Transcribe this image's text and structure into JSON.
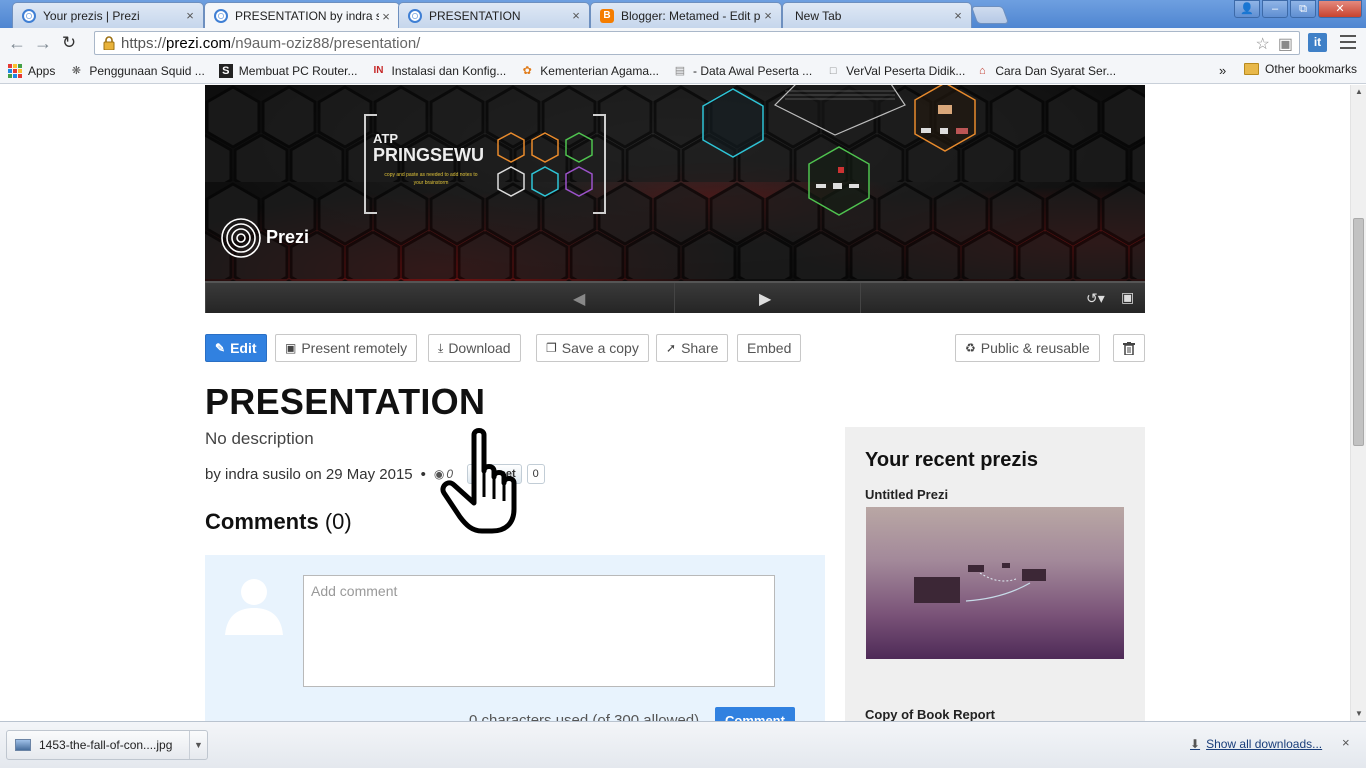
{
  "browser": {
    "tabs": [
      {
        "title": "Your prezis | Prezi",
        "icon": "prezi-icon",
        "active": false
      },
      {
        "title": "PRESENTATION by indra s",
        "icon": "prezi-icon",
        "active": true
      },
      {
        "title": "PRESENTATION",
        "icon": "prezi-icon",
        "active": false
      },
      {
        "title": "Blogger: Metamed - Edit p",
        "icon": "blogger-icon",
        "active": false
      },
      {
        "title": "New Tab",
        "icon": "",
        "active": false
      }
    ],
    "close_glyph": "×",
    "url_scheme": "https://",
    "url_host": "prezi.com",
    "url_path": "/n9aum-oziz88/presentation/",
    "extension_label": "it",
    "bookmarks": [
      {
        "label": "Apps",
        "icon": "apps-grid-icon"
      },
      {
        "label": "Penggunaan Squid ...",
        "icon": "squid-icon"
      },
      {
        "label": "Membuat PC Router...",
        "icon": "s-logo-icon"
      },
      {
        "label": "Instalasi dan Konfig...",
        "icon": "in-logo-icon"
      },
      {
        "label": "Kementerian Agama...",
        "icon": "leaf-icon"
      },
      {
        "label": "- Data Awal Peserta ...",
        "icon": "doc-icon"
      },
      {
        "label": "VerVal Peserta Didik...",
        "icon": "page-icon"
      },
      {
        "label": "Cara Dan Syarat Ser...",
        "icon": "house-icon"
      }
    ],
    "bookmarks_overflow": "»",
    "other_bookmarks": "Other bookmarks"
  },
  "player": {
    "slide_title_small": "ATP",
    "slide_title_big": "PRINGSEWU",
    "slide_hint": "copy and paste as needed to add notes to your brainstorm",
    "brand": "Prezi",
    "colors": {
      "accent_cyan": "#2ec4d6",
      "accent_orange": "#e88a2c",
      "accent_green": "#4fc34f",
      "accent_purple": "#9b52c9"
    }
  },
  "actions": {
    "edit": "Edit",
    "present_remotely": "Present remotely",
    "download": "Download",
    "save_copy": "Save a copy",
    "share": "Share",
    "embed": "Embed",
    "public_reusable": "Public & reusable"
  },
  "presentation": {
    "title": "PRESENTATION",
    "description": "No description",
    "by_prefix": "by",
    "author": "indra susilo",
    "date_prefix": "on",
    "date": "29 May 2015",
    "bullet": "•",
    "views": "0",
    "tweet_label": "Tweet",
    "tweet_count": "0"
  },
  "comments": {
    "heading": "Comments",
    "count": "(0)",
    "placeholder": "Add comment",
    "char_info": "0 characters used (of 300 allowed)",
    "submit": "Comment"
  },
  "sidebar": {
    "title": "Your recent prezis",
    "items": [
      {
        "name": "Untitled Prezi"
      },
      {
        "name": "Copy of Book Report"
      }
    ]
  },
  "downloads": {
    "file": "1453-the-fall-of-con....jpg",
    "show_all": "Show all downloads...",
    "close": "×"
  }
}
